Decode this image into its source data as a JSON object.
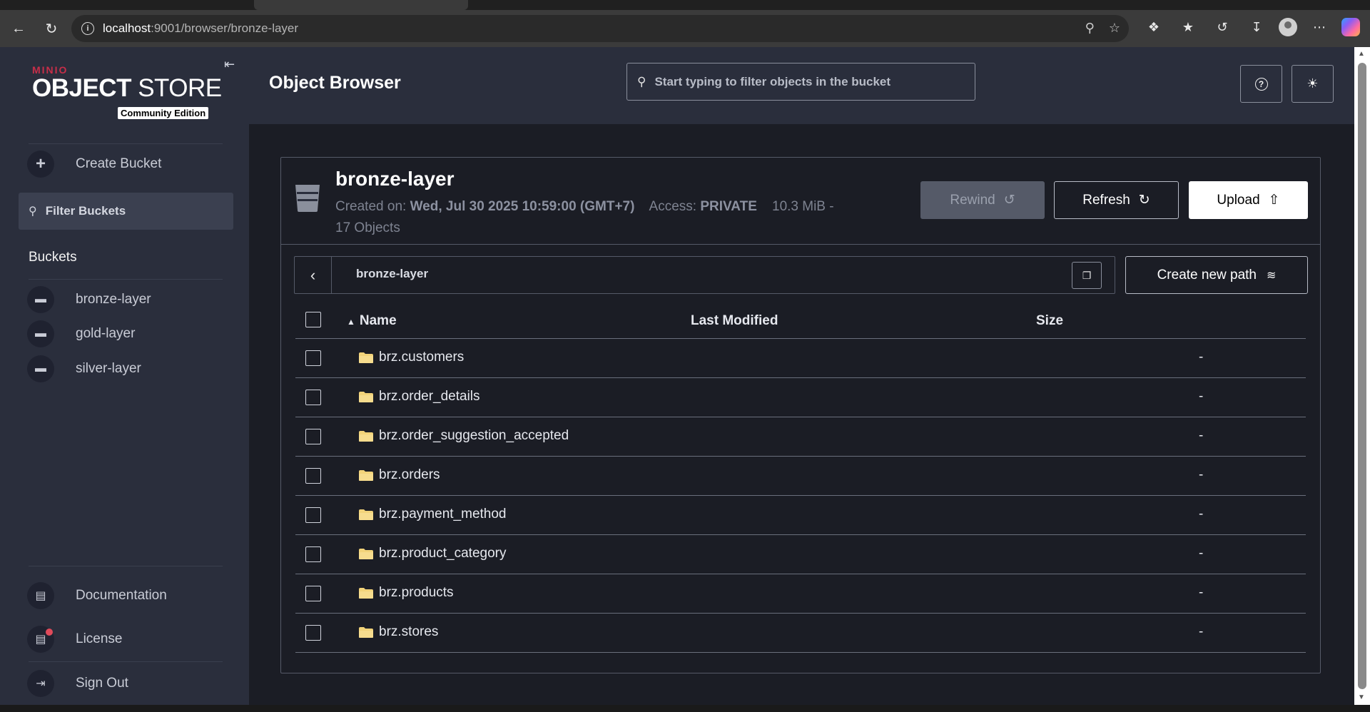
{
  "browser": {
    "url_host": "localhost",
    "url_rest": ":9001/browser/bronze-layer"
  },
  "sidebar": {
    "logo_brand": "MINIO",
    "logo_object": "OBJECT",
    "logo_store": "STORE",
    "logo_edition": "Community Edition",
    "create_bucket": "Create Bucket",
    "filter_placeholder": "Filter Buckets",
    "buckets_title": "Buckets",
    "buckets": [
      {
        "label": "bronze-layer"
      },
      {
        "label": "gold-layer"
      },
      {
        "label": "silver-layer"
      }
    ],
    "documentation": "Documentation",
    "license": "License",
    "sign_out": "Sign Out"
  },
  "header": {
    "title": "Object Browser",
    "search_placeholder": "Start typing to filter objects in the bucket"
  },
  "bucket": {
    "name": "bronze-layer",
    "created_label": "Created on:",
    "created_value": "Wed, Jul 30 2025 10:59:00 (GMT+7)",
    "access_label": "Access:",
    "access_value": "PRIVATE",
    "size_info": "10.3 MiB -",
    "objects_info": "17 Objects",
    "rewind": "Rewind",
    "refresh": "Refresh",
    "upload": "Upload"
  },
  "breadcrumb": {
    "path": "bronze-layer",
    "create_new_path": "Create new path"
  },
  "table": {
    "columns": {
      "name": "Name",
      "modified": "Last Modified",
      "size": "Size"
    },
    "rows": [
      {
        "name": "brz.customers",
        "modified": "",
        "size": "-"
      },
      {
        "name": "brz.order_details",
        "modified": "",
        "size": "-"
      },
      {
        "name": "brz.order_suggestion_accepted",
        "modified": "",
        "size": "-"
      },
      {
        "name": "brz.orders",
        "modified": "",
        "size": "-"
      },
      {
        "name": "brz.payment_method",
        "modified": "",
        "size": "-"
      },
      {
        "name": "brz.product_category",
        "modified": "",
        "size": "-"
      },
      {
        "name": "brz.products",
        "modified": "",
        "size": "-"
      },
      {
        "name": "brz.stores",
        "modified": "",
        "size": "-"
      }
    ]
  },
  "colors": {
    "sidebar_bg": "#2a2e3c",
    "content_bg": "#1b1d25",
    "brand_red": "#c72e49",
    "folder": "#f2d37a"
  }
}
